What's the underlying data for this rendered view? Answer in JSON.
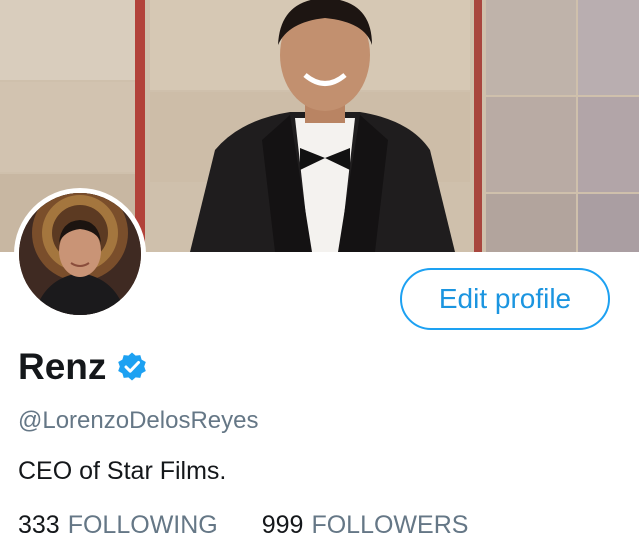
{
  "profile": {
    "name": "Renz",
    "handle": "@LorenzoDelosReyes",
    "bio": "CEO of Star Films.",
    "edit_label": "Edit profile",
    "verified": true,
    "following_count": "333",
    "following_label": "FOLLOWING",
    "followers_count": "999",
    "followers_label": "FOLLOWERS"
  },
  "colors": {
    "accent": "#1da1f2",
    "text_primary": "#14171a",
    "text_secondary": "#657786"
  },
  "icons": {
    "verified": "verified-badge-icon"
  }
}
